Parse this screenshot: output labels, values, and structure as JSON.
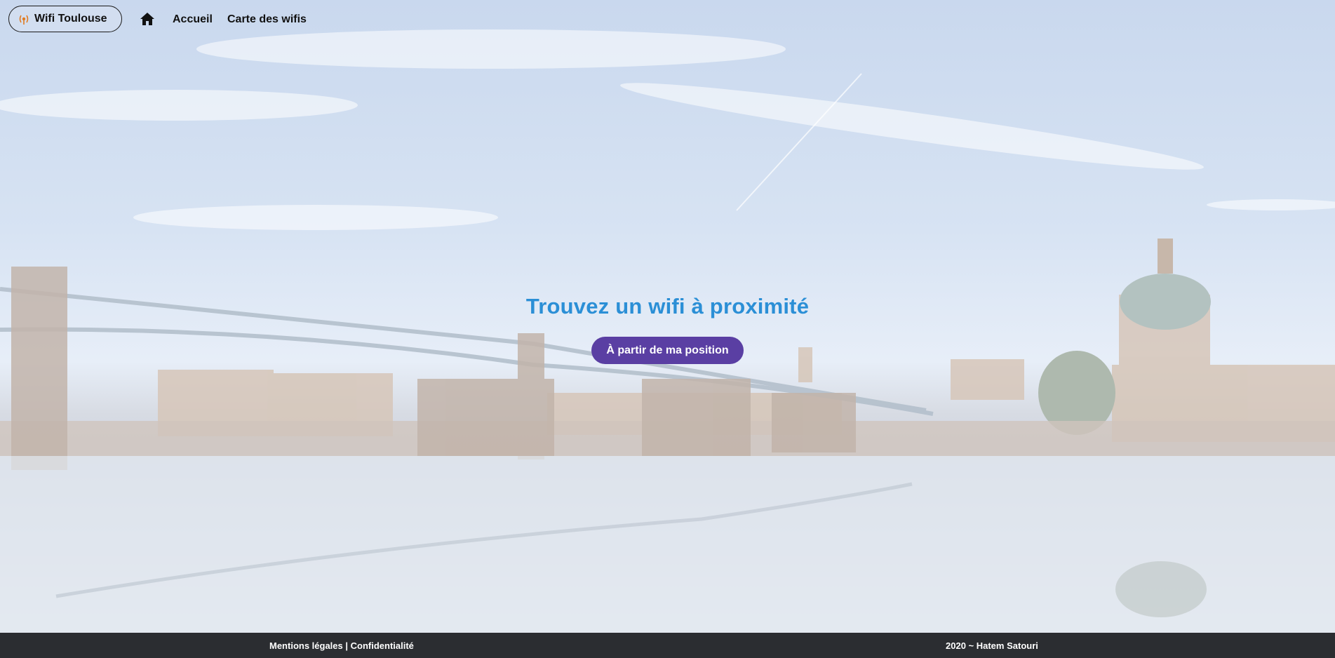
{
  "nav": {
    "brand_label": "Wifi Toulouse",
    "home_icon": "home-icon",
    "links": [
      "Accueil",
      "Carte des wifis"
    ]
  },
  "hero": {
    "title": "Trouvez un wifi à proximité",
    "button_label": "À partir de ma position"
  },
  "footer": {
    "legal_label": "Mentions légales",
    "separator": " | ",
    "privacy_label": "Confidentialité",
    "credit": "2020 ~ Hatem Satouri"
  },
  "colors": {
    "title": "#2b8fd6",
    "button": "#5a3fa3",
    "footer_bg": "#2b2d31"
  }
}
